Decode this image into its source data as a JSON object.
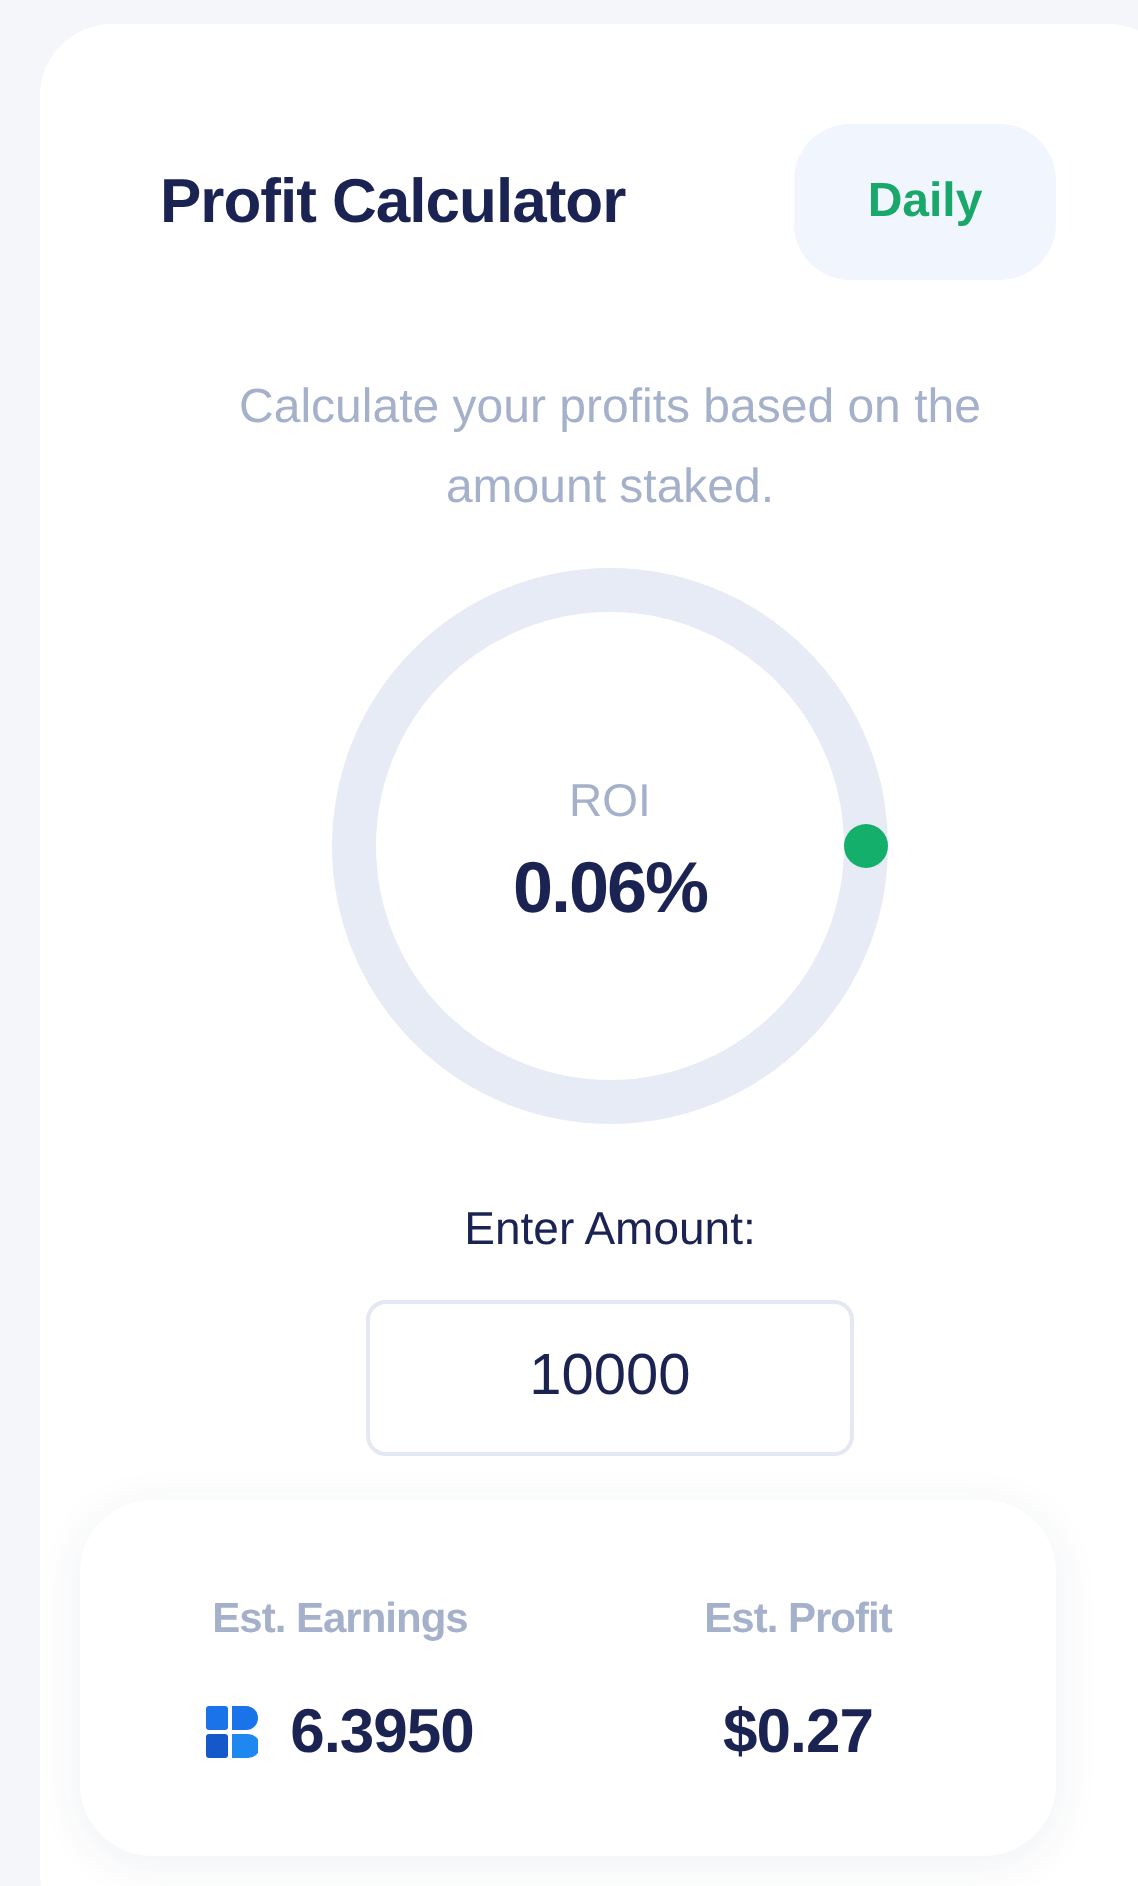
{
  "header": {
    "title": "Profit Calculator",
    "period_button": "Daily"
  },
  "description": "Calculate your profits based on the amount staked.",
  "roi": {
    "label": "ROI",
    "value": "0.06%"
  },
  "amount": {
    "label": "Enter Amount:",
    "value": "10000"
  },
  "results": [
    {
      "label": "Est. Earnings",
      "value": "6.3950",
      "kind": "token"
    },
    {
      "label": "Est. Profit",
      "value": "$0.27",
      "kind": "plain"
    }
  ]
}
